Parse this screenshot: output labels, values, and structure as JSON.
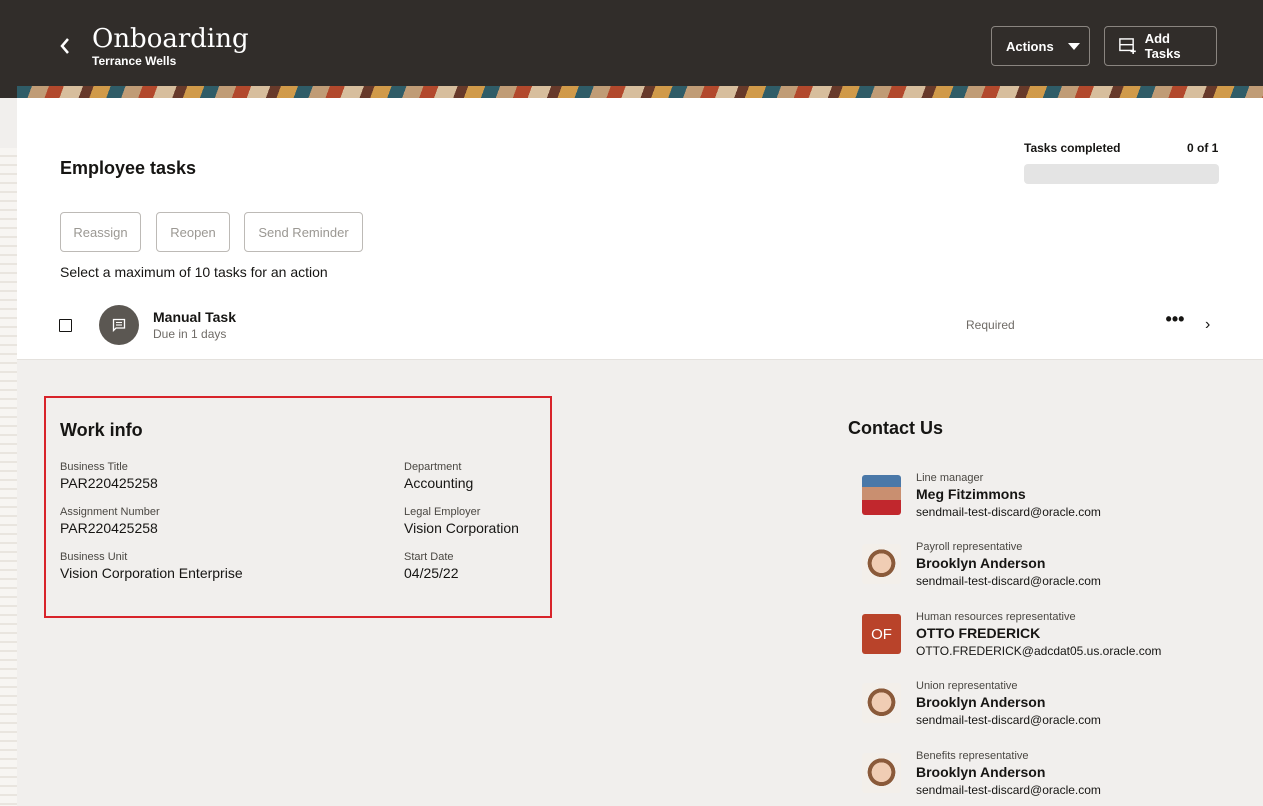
{
  "header": {
    "title": "Onboarding",
    "subtitle": "Terrance Wells",
    "actions_label": "Actions",
    "add_tasks_label": "Add Tasks",
    "background_color": "#312d2a"
  },
  "tasks_panel": {
    "title": "Employee tasks",
    "progress": {
      "label": "Tasks completed",
      "count_text": "0 of 1",
      "fraction": 0
    },
    "buttons": {
      "reassign": "Reassign",
      "reopen": "Reopen",
      "send_reminder": "Send Reminder"
    },
    "note": "Select a maximum of 10 tasks for an action",
    "tasks": [
      {
        "name": "Manual Task",
        "due": "Due in 1 days",
        "status": "Required",
        "more": "•••",
        "chevron": "›",
        "icon": "chat-icon"
      }
    ]
  },
  "work_info": {
    "title": "Work info",
    "fields": {
      "business_title": {
        "label": "Business Title",
        "value": "PAR220425258"
      },
      "department": {
        "label": "Department",
        "value": "Accounting"
      },
      "assignment_number": {
        "label": "Assignment Number",
        "value": "PAR220425258"
      },
      "legal_employer": {
        "label": "Legal Employer",
        "value": "Vision Corporation"
      },
      "business_unit": {
        "label": "Business Unit",
        "value": "Vision Corporation Enterprise"
      },
      "start_date": {
        "label": "Start Date",
        "value": "04/25/22"
      }
    },
    "highlight_color": "#d8232a"
  },
  "contact_us": {
    "title": "Contact Us",
    "contacts": [
      {
        "role": "Line manager",
        "name": "Meg Fitzimmons",
        "email": "sendmail-test-discard@oracle.com",
        "avatar": "photo"
      },
      {
        "role": "Payroll representative",
        "name": "Brooklyn Anderson",
        "email": "sendmail-test-discard@oracle.com",
        "avatar": "photo"
      },
      {
        "role": "Human resources representative",
        "name": "OTTO FREDERICK",
        "email": "OTTO.FREDERICK@adcdat05.us.oracle.com",
        "avatar": "OF"
      },
      {
        "role": "Union representative",
        "name": "Brooklyn Anderson",
        "email": "sendmail-test-discard@oracle.com",
        "avatar": "photo"
      },
      {
        "role": "Benefits representative",
        "name": "Brooklyn Anderson",
        "email": "sendmail-test-discard@oracle.com",
        "avatar": "photo"
      }
    ]
  }
}
